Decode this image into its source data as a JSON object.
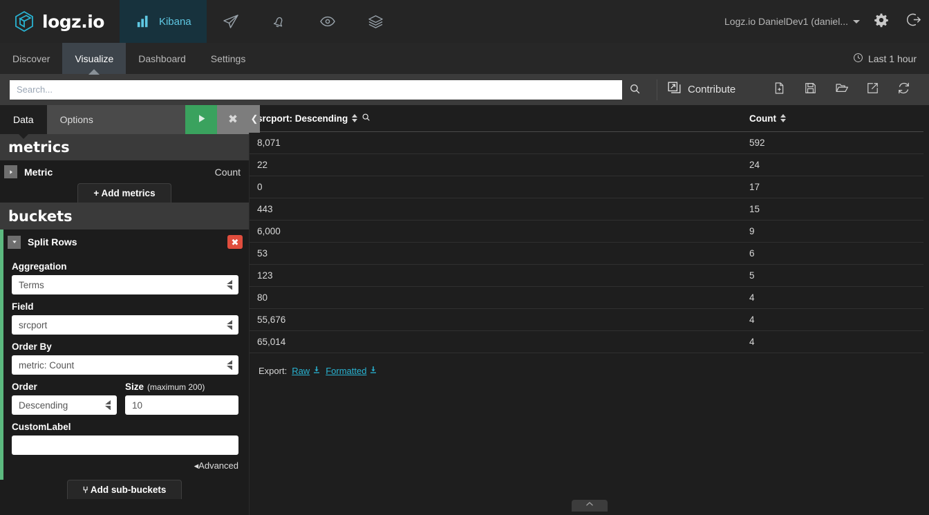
{
  "topbar": {
    "brand": "logz.io",
    "brand_logo_icon": "logzio-cube-icon",
    "nav": [
      {
        "label": "Kibana",
        "icon": "bar-chart-icon",
        "active": true
      },
      {
        "label": "",
        "icon": "paper-plane-icon",
        "active": false
      },
      {
        "label": "",
        "icon": "bell-icon",
        "active": false
      },
      {
        "label": "",
        "icon": "eye-icon",
        "active": false
      },
      {
        "label": "",
        "icon": "layers-icon",
        "active": false
      }
    ],
    "user_menu": "Logz.io DanielDev1 (daniel...",
    "settings_icon": "gear-icon",
    "logout_icon": "logout-icon",
    "accent_color": "#29b3d2"
  },
  "tabs": {
    "items": [
      {
        "label": "Discover",
        "active": false
      },
      {
        "label": "Visualize",
        "active": true
      },
      {
        "label": "Dashboard",
        "active": false
      },
      {
        "label": "Settings",
        "active": false
      }
    ],
    "timepicker": {
      "label": "Last 1 hour",
      "icon": "clock-icon"
    }
  },
  "querybar": {
    "search_placeholder": "Search...",
    "search_value": "",
    "search_icon": "search-icon",
    "contribute_label": "Contribute",
    "contribute_icon": "external-window-icon",
    "actions": [
      {
        "name": "new-visualization",
        "icon": "new-document-icon"
      },
      {
        "name": "save-visualization",
        "icon": "floppy-save-icon"
      },
      {
        "name": "open-visualization",
        "icon": "folder-open-icon"
      },
      {
        "name": "share-visualization",
        "icon": "share-external-icon"
      },
      {
        "name": "refresh-visualization",
        "icon": "refresh-icon"
      }
    ]
  },
  "editor": {
    "tabs": [
      {
        "label": "Data",
        "active": true
      },
      {
        "label": "Options",
        "active": false
      }
    ],
    "apply_icon": "play-triangle-icon",
    "cancel_icon": "close-x-icon",
    "collapse_icon": "chevron-left-icon",
    "metrics": {
      "title": "metrics",
      "rows": [
        {
          "label": "Metric",
          "value": "Count",
          "toggle_icon": "triangle-right-icon"
        }
      ],
      "add_label": "+ Add metrics"
    },
    "buckets": {
      "title": "buckets",
      "bucket_label": "Split Rows",
      "toggle_icon": "triangle-down-icon",
      "remove_icon": "close-x-icon",
      "accent_color": "#5cb97f",
      "fields": {
        "aggregation_label": "Aggregation",
        "aggregation_value": "Terms",
        "field_label": "Field",
        "field_value": "srcport",
        "order_by_label": "Order By",
        "order_by_value": "metric: Count",
        "order_label": "Order",
        "order_value": "Descending",
        "size_label": "Size",
        "size_hint": "(maximum 200)",
        "size_value": "10",
        "custom_label_label": "CustomLabel",
        "custom_label_value": ""
      },
      "advanced_label": "Advanced",
      "advanced_icon": "triangle-left-icon",
      "add_sub_buckets_label": "Add sub-buckets",
      "add_sub_buckets_icon": "branch-icon"
    }
  },
  "table": {
    "columns": [
      {
        "label": "srcport: Descending",
        "sort_icon": "sort-updown-icon",
        "filter_icon": "search-icon"
      },
      {
        "label": "Count",
        "sort_icon": "sort-updown-icon"
      }
    ],
    "rows": [
      {
        "key": "8,071",
        "count": "592"
      },
      {
        "key": "22",
        "count": "24"
      },
      {
        "key": "0",
        "count": "17"
      },
      {
        "key": "443",
        "count": "15"
      },
      {
        "key": "6,000",
        "count": "9"
      },
      {
        "key": "53",
        "count": "6"
      },
      {
        "key": "123",
        "count": "5"
      },
      {
        "key": "80",
        "count": "4"
      },
      {
        "key": "55,676",
        "count": "4"
      },
      {
        "key": "65,014",
        "count": "4"
      }
    ],
    "export_label": "Export:",
    "export_raw": "Raw",
    "export_formatted": "Formatted",
    "export_icon": "download-icon",
    "link_color": "#29b3d2"
  },
  "viz_handle_icon": "chevron-up-icon"
}
